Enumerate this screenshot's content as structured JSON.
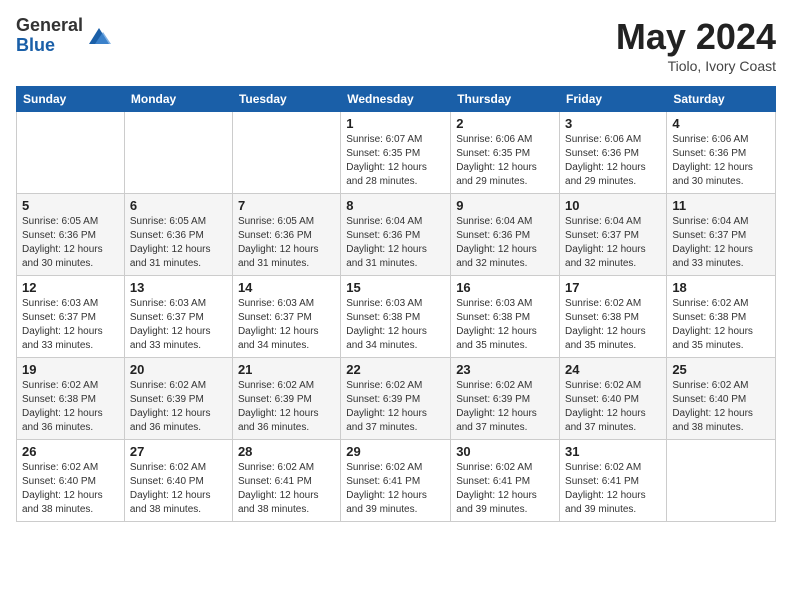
{
  "header": {
    "logo_general": "General",
    "logo_blue": "Blue",
    "month_year": "May 2024",
    "location": "Tiolo, Ivory Coast"
  },
  "days_of_week": [
    "Sunday",
    "Monday",
    "Tuesday",
    "Wednesday",
    "Thursday",
    "Friday",
    "Saturday"
  ],
  "weeks": [
    [
      {
        "day": "",
        "detail": ""
      },
      {
        "day": "",
        "detail": ""
      },
      {
        "day": "",
        "detail": ""
      },
      {
        "day": "1",
        "detail": "Sunrise: 6:07 AM\nSunset: 6:35 PM\nDaylight: 12 hours\nand 28 minutes."
      },
      {
        "day": "2",
        "detail": "Sunrise: 6:06 AM\nSunset: 6:35 PM\nDaylight: 12 hours\nand 29 minutes."
      },
      {
        "day": "3",
        "detail": "Sunrise: 6:06 AM\nSunset: 6:36 PM\nDaylight: 12 hours\nand 29 minutes."
      },
      {
        "day": "4",
        "detail": "Sunrise: 6:06 AM\nSunset: 6:36 PM\nDaylight: 12 hours\nand 30 minutes."
      }
    ],
    [
      {
        "day": "5",
        "detail": "Sunrise: 6:05 AM\nSunset: 6:36 PM\nDaylight: 12 hours\nand 30 minutes."
      },
      {
        "day": "6",
        "detail": "Sunrise: 6:05 AM\nSunset: 6:36 PM\nDaylight: 12 hours\nand 31 minutes."
      },
      {
        "day": "7",
        "detail": "Sunrise: 6:05 AM\nSunset: 6:36 PM\nDaylight: 12 hours\nand 31 minutes."
      },
      {
        "day": "8",
        "detail": "Sunrise: 6:04 AM\nSunset: 6:36 PM\nDaylight: 12 hours\nand 31 minutes."
      },
      {
        "day": "9",
        "detail": "Sunrise: 6:04 AM\nSunset: 6:36 PM\nDaylight: 12 hours\nand 32 minutes."
      },
      {
        "day": "10",
        "detail": "Sunrise: 6:04 AM\nSunset: 6:37 PM\nDaylight: 12 hours\nand 32 minutes."
      },
      {
        "day": "11",
        "detail": "Sunrise: 6:04 AM\nSunset: 6:37 PM\nDaylight: 12 hours\nand 33 minutes."
      }
    ],
    [
      {
        "day": "12",
        "detail": "Sunrise: 6:03 AM\nSunset: 6:37 PM\nDaylight: 12 hours\nand 33 minutes."
      },
      {
        "day": "13",
        "detail": "Sunrise: 6:03 AM\nSunset: 6:37 PM\nDaylight: 12 hours\nand 33 minutes."
      },
      {
        "day": "14",
        "detail": "Sunrise: 6:03 AM\nSunset: 6:37 PM\nDaylight: 12 hours\nand 34 minutes."
      },
      {
        "day": "15",
        "detail": "Sunrise: 6:03 AM\nSunset: 6:38 PM\nDaylight: 12 hours\nand 34 minutes."
      },
      {
        "day": "16",
        "detail": "Sunrise: 6:03 AM\nSunset: 6:38 PM\nDaylight: 12 hours\nand 35 minutes."
      },
      {
        "day": "17",
        "detail": "Sunrise: 6:02 AM\nSunset: 6:38 PM\nDaylight: 12 hours\nand 35 minutes."
      },
      {
        "day": "18",
        "detail": "Sunrise: 6:02 AM\nSunset: 6:38 PM\nDaylight: 12 hours\nand 35 minutes."
      }
    ],
    [
      {
        "day": "19",
        "detail": "Sunrise: 6:02 AM\nSunset: 6:38 PM\nDaylight: 12 hours\nand 36 minutes."
      },
      {
        "day": "20",
        "detail": "Sunrise: 6:02 AM\nSunset: 6:39 PM\nDaylight: 12 hours\nand 36 minutes."
      },
      {
        "day": "21",
        "detail": "Sunrise: 6:02 AM\nSunset: 6:39 PM\nDaylight: 12 hours\nand 36 minutes."
      },
      {
        "day": "22",
        "detail": "Sunrise: 6:02 AM\nSunset: 6:39 PM\nDaylight: 12 hours\nand 37 minutes."
      },
      {
        "day": "23",
        "detail": "Sunrise: 6:02 AM\nSunset: 6:39 PM\nDaylight: 12 hours\nand 37 minutes."
      },
      {
        "day": "24",
        "detail": "Sunrise: 6:02 AM\nSunset: 6:40 PM\nDaylight: 12 hours\nand 37 minutes."
      },
      {
        "day": "25",
        "detail": "Sunrise: 6:02 AM\nSunset: 6:40 PM\nDaylight: 12 hours\nand 38 minutes."
      }
    ],
    [
      {
        "day": "26",
        "detail": "Sunrise: 6:02 AM\nSunset: 6:40 PM\nDaylight: 12 hours\nand 38 minutes."
      },
      {
        "day": "27",
        "detail": "Sunrise: 6:02 AM\nSunset: 6:40 PM\nDaylight: 12 hours\nand 38 minutes."
      },
      {
        "day": "28",
        "detail": "Sunrise: 6:02 AM\nSunset: 6:41 PM\nDaylight: 12 hours\nand 38 minutes."
      },
      {
        "day": "29",
        "detail": "Sunrise: 6:02 AM\nSunset: 6:41 PM\nDaylight: 12 hours\nand 39 minutes."
      },
      {
        "day": "30",
        "detail": "Sunrise: 6:02 AM\nSunset: 6:41 PM\nDaylight: 12 hours\nand 39 minutes."
      },
      {
        "day": "31",
        "detail": "Sunrise: 6:02 AM\nSunset: 6:41 PM\nDaylight: 12 hours\nand 39 minutes."
      },
      {
        "day": "",
        "detail": ""
      }
    ]
  ]
}
